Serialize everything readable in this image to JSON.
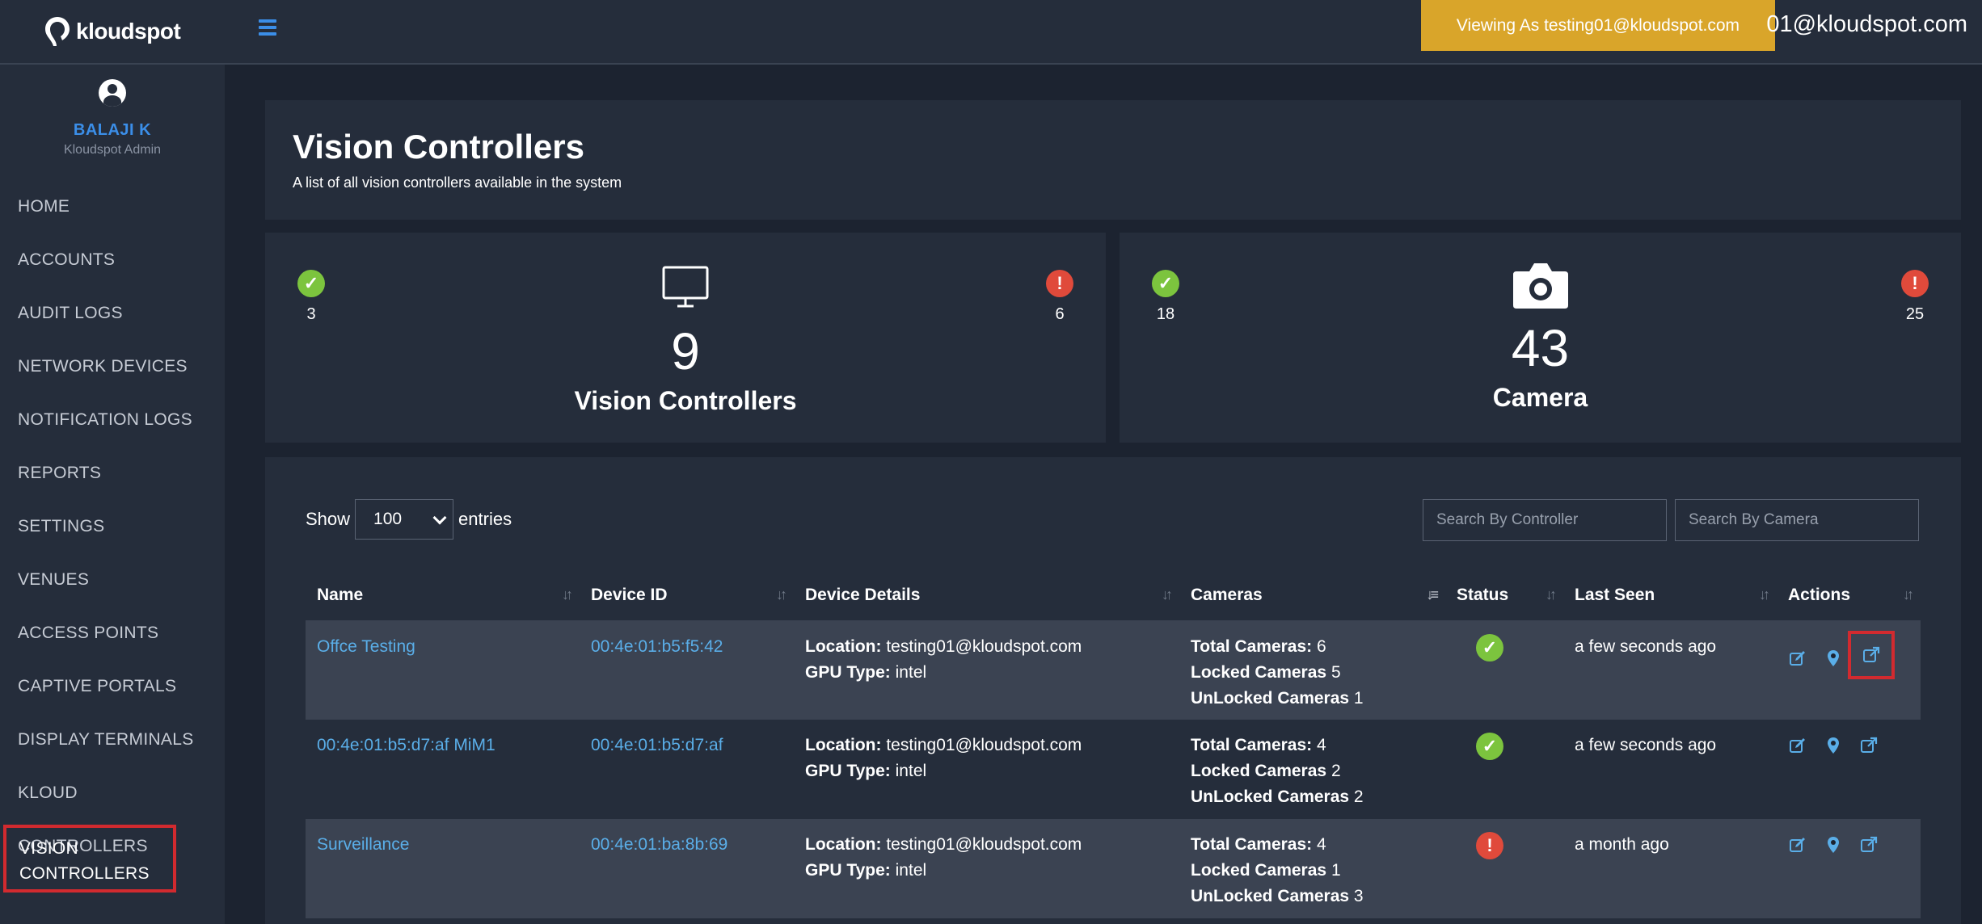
{
  "brand": {
    "name": "kloudspot"
  },
  "user": {
    "name": "BALAJI K",
    "role": "Kloudspot Admin"
  },
  "sidebar": {
    "items": [
      {
        "label": "HOME"
      },
      {
        "label": "ACCOUNTS"
      },
      {
        "label": "AUDIT LOGS"
      },
      {
        "label": "NETWORK DEVICES"
      },
      {
        "label": "NOTIFICATION LOGS"
      },
      {
        "label": "REPORTS"
      },
      {
        "label": "SETTINGS"
      },
      {
        "label": "VENUES"
      },
      {
        "label": "ACCESS POINTS"
      },
      {
        "label": "CAPTIVE PORTALS"
      },
      {
        "label": "DISPLAY TERMINALS"
      },
      {
        "label": "KLOUD CONTROLLERS"
      },
      {
        "label": "VISION CONTROLLERS",
        "active": true
      }
    ]
  },
  "topbar": {
    "viewing_as": "Viewing As testing01@kloudspot.com",
    "email": "01@kloudspot.com"
  },
  "page": {
    "title": "Vision Controllers",
    "subtitle": "A list of all vision controllers available in the system"
  },
  "stats": {
    "controllers": {
      "ok": "3",
      "err": "6",
      "total": "9",
      "label": "Vision Controllers",
      "icon": "monitor-icon"
    },
    "cameras": {
      "ok": "18",
      "err": "25",
      "total": "43",
      "label": "Camera",
      "icon": "camera-icon"
    }
  },
  "table_controls": {
    "show_label": "Show",
    "page_size": "100",
    "entries_label": "entries",
    "search_controller_placeholder": "Search By Controller",
    "search_camera_placeholder": "Search By Camera"
  },
  "table": {
    "columns": [
      "Name",
      "Device ID",
      "Device Details",
      "Cameras",
      "Status",
      "Last Seen",
      "Actions"
    ],
    "location_label": "Location:",
    "gpu_label": "GPU Type:",
    "total_label": "Total Cameras:",
    "locked_label": "Locked Cameras",
    "unlocked_label": "UnLocked Cameras",
    "rows": [
      {
        "name": "Offce Testing",
        "device_id": "00:4e:01:b5:f5:42",
        "location": "testing01@kloudspot.com",
        "gpu": "intel",
        "total": "6",
        "locked": "5",
        "unlocked": "1",
        "status": "ok",
        "last_seen": "a few seconds ago"
      },
      {
        "name": "00:4e:01:b5:d7:af MiM1",
        "device_id": "00:4e:01:b5:d7:af",
        "location": "testing01@kloudspot.com",
        "gpu": "intel",
        "total": "4",
        "locked": "2",
        "unlocked": "2",
        "status": "ok",
        "last_seen": "a few seconds ago"
      },
      {
        "name": "Surveillance",
        "device_id": "00:4e:01:ba:8b:69",
        "location": "testing01@kloudspot.com",
        "gpu": "intel",
        "total": "4",
        "locked": "1",
        "unlocked": "3",
        "status": "err",
        "last_seen": "a month ago"
      }
    ]
  },
  "colors": {
    "accent": "#3b8ee8",
    "ok": "#7cc43e",
    "error": "#e04a3b",
    "banner": "#d9a52a",
    "highlight": "#d22a2f"
  }
}
